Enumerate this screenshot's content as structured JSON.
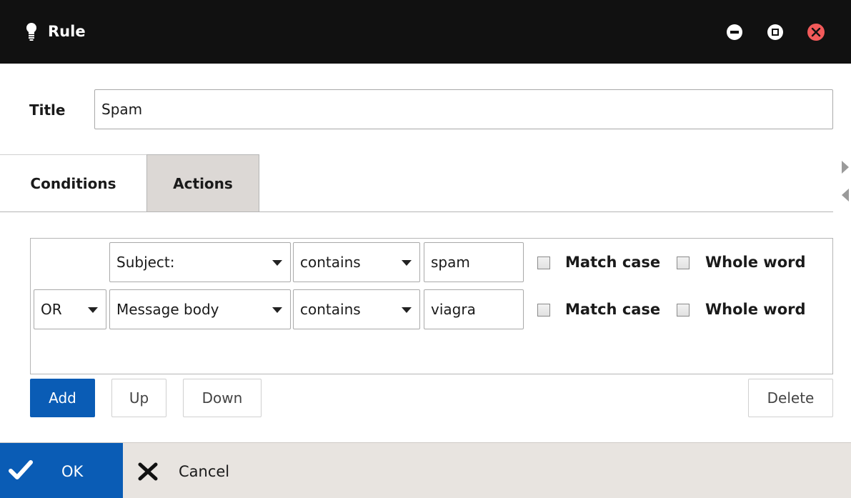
{
  "window": {
    "title": "Rule",
    "icon": "lightbulb-icon"
  },
  "form": {
    "title_label": "Title",
    "title_value": "Spam"
  },
  "tabs": [
    {
      "label": "Conditions",
      "active": true
    },
    {
      "label": "Actions",
      "active": false
    }
  ],
  "conditions": [
    {
      "operator": "",
      "field": "Subject:",
      "match": "contains",
      "value": "spam",
      "match_case_label": "Match case",
      "match_case": false,
      "whole_word_label": "Whole word",
      "whole_word": false
    },
    {
      "operator": "OR",
      "field": "Message body",
      "match": "contains",
      "value": "viagra",
      "match_case_label": "Match case",
      "match_case": false,
      "whole_word_label": "Whole word",
      "whole_word": false
    }
  ],
  "panel_buttons": {
    "add": "Add",
    "up": "Up",
    "down": "Down",
    "delete": "Delete"
  },
  "footer": {
    "ok": "OK",
    "cancel": "Cancel"
  },
  "colors": {
    "accent": "#0a5cb5",
    "titlebar": "#111111",
    "close": "#f25a5a",
    "footer": "#e8e4e0"
  }
}
